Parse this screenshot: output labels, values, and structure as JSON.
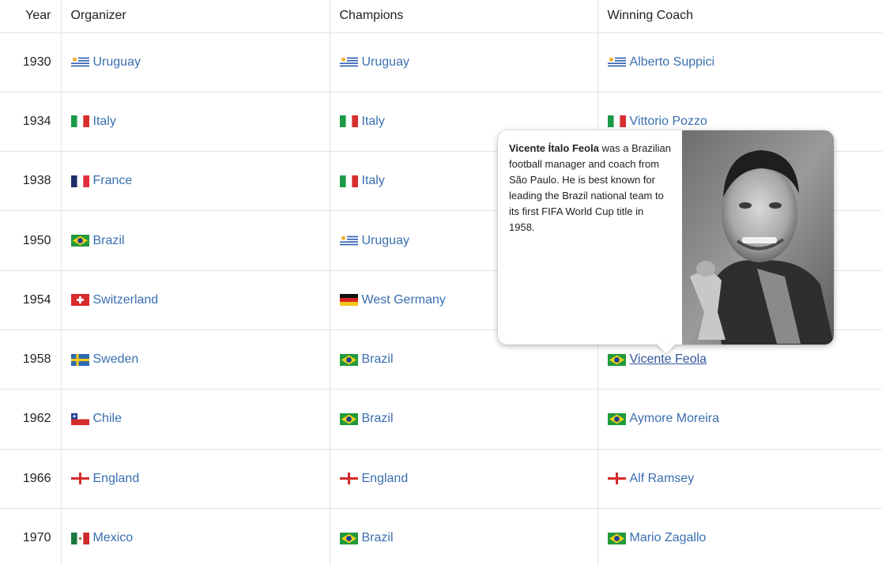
{
  "table": {
    "headers": {
      "year": "Year",
      "organizer": "Organizer",
      "champions": "Champions",
      "coach": "Winning Coach"
    },
    "rows": [
      {
        "year": "1930",
        "organizer": "Uruguay",
        "org_flag": "uruguay",
        "champion": "Uruguay",
        "champ_flag": "uruguay",
        "coach": "Alberto Suppici",
        "coach_flag": "uruguay"
      },
      {
        "year": "1934",
        "organizer": "Italy",
        "org_flag": "italy",
        "champion": "Italy",
        "champ_flag": "italy",
        "coach": "Vittorio Pozzo",
        "coach_flag": "italy"
      },
      {
        "year": "1938",
        "organizer": "France",
        "org_flag": "france",
        "champion": "Italy",
        "champ_flag": "italy",
        "coach": "",
        "coach_flag": ""
      },
      {
        "year": "1950",
        "organizer": "Brazil",
        "org_flag": "brazil",
        "champion": "Uruguay",
        "champ_flag": "uruguay",
        "coach": "",
        "coach_flag": ""
      },
      {
        "year": "1954",
        "organizer": "Switzerland",
        "org_flag": "switzerland",
        "champion": "West Germany",
        "champ_flag": "germany",
        "coach": "",
        "coach_flag": ""
      },
      {
        "year": "1958",
        "organizer": "Sweden",
        "org_flag": "sweden",
        "champion": "Brazil",
        "champ_flag": "brazil",
        "coach": "Vicente Feola",
        "coach_flag": "brazil"
      },
      {
        "year": "1962",
        "organizer": "Chile",
        "org_flag": "chile",
        "champion": "Brazil",
        "champ_flag": "brazil",
        "coach": "Aymore Moreira",
        "coach_flag": "brazil"
      },
      {
        "year": "1966",
        "organizer": "England",
        "org_flag": "england",
        "champion": "England",
        "champ_flag": "england",
        "coach": "Alf Ramsey",
        "coach_flag": "england"
      },
      {
        "year": "1970",
        "organizer": "Mexico",
        "org_flag": "mexico",
        "champion": "Brazil",
        "champ_flag": "brazil",
        "coach": "Mario Zagallo",
        "coach_flag": "brazil"
      }
    ]
  },
  "popup": {
    "name": "Vicente Ítalo Feola",
    "description": " was a Brazilian football manager and coach from São Paulo. He is best known for leading the Brazil national team to its first FIFA World Cup title in 1958.",
    "image_icon": "portrait-photo"
  },
  "colors": {
    "link": "#3a6fb0",
    "border": "#e3e3e3",
    "text": "#202122"
  }
}
